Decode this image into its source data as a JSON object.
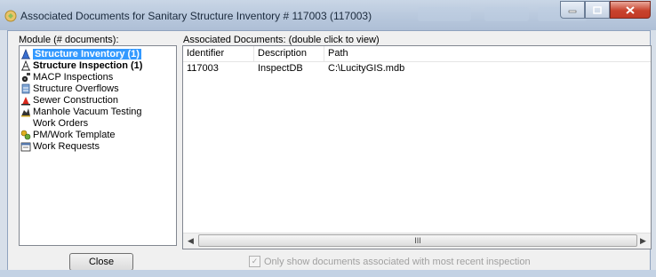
{
  "window": {
    "title": "Associated Documents for Sanitary Structure Inventory # 117003 (117003)",
    "colors": {
      "selection": "#3399ff",
      "close_button": "#c8432d",
      "frame": "#b7c7dc"
    }
  },
  "modules": {
    "label": "Module (# documents):",
    "items": [
      {
        "label": "Structure Inventory (1)",
        "icon": "structure-icon",
        "selected": true,
        "bold": true
      },
      {
        "label": "Structure Inspection (1)",
        "icon": "inspection-icon",
        "selected": false,
        "bold": true
      },
      {
        "label": "MACP Inspections",
        "icon": "camera-icon",
        "selected": false,
        "bold": false
      },
      {
        "label": "Structure Overflows",
        "icon": "overflow-icon",
        "selected": false,
        "bold": false
      },
      {
        "label": "Sewer Construction",
        "icon": "construction-icon",
        "selected": false,
        "bold": false
      },
      {
        "label": "Manhole Vacuum Testing",
        "icon": "vacuum-icon",
        "selected": false,
        "bold": false
      },
      {
        "label": "Work Orders",
        "icon": "",
        "selected": false,
        "bold": false
      },
      {
        "label": "PM/Work Template",
        "icon": "template-icon",
        "selected": false,
        "bold": false
      },
      {
        "label": "Work Requests",
        "icon": "calendar-icon",
        "selected": false,
        "bold": false
      }
    ]
  },
  "documents": {
    "label": "Associated Documents:  (double click to view)",
    "columns": [
      "Identifier",
      "Description",
      "Path"
    ],
    "rows": [
      [
        "117003",
        "InspectDB",
        "C:\\LucityGIS.mdb"
      ]
    ],
    "scroll_label": "III"
  },
  "close_button": "Close",
  "recent_inspection_checkbox": {
    "label": "Only show documents associated with most recent inspection",
    "checked": true,
    "enabled": false
  }
}
